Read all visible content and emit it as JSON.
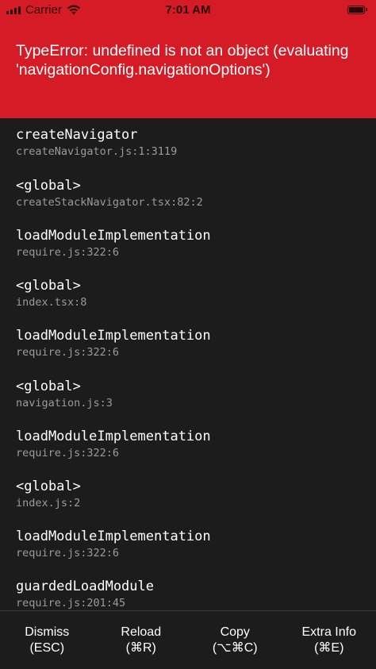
{
  "status_bar": {
    "carrier": "Carrier",
    "time": "7:01 AM",
    "icons": [
      "signal-icon",
      "wifi-icon",
      "battery-icon"
    ]
  },
  "error": {
    "message": "TypeError: undefined is not an object (evaluating 'navigationConfig.navigationOptions')"
  },
  "stack_frames": [
    {
      "method": "createNavigator",
      "location": "createNavigator.js:1:3119"
    },
    {
      "method": "<global>",
      "location": "createStackNavigator.tsx:82:2"
    },
    {
      "method": "loadModuleImplementation",
      "location": "require.js:322:6"
    },
    {
      "method": "<global>",
      "location": "index.tsx:8"
    },
    {
      "method": "loadModuleImplementation",
      "location": "require.js:322:6"
    },
    {
      "method": "<global>",
      "location": "navigation.js:3"
    },
    {
      "method": "loadModuleImplementation",
      "location": "require.js:322:6"
    },
    {
      "method": "<global>",
      "location": "index.js:2"
    },
    {
      "method": "loadModuleImplementation",
      "location": "require.js:322:6"
    },
    {
      "method": "guardedLoadModule",
      "location": "require.js:201:45"
    }
  ],
  "footer": {
    "dismiss": {
      "label": "Dismiss",
      "shortcut": "(ESC)"
    },
    "reload": {
      "label": "Reload",
      "shortcut": "(⌘R)"
    },
    "copy": {
      "label": "Copy",
      "shortcut": "(⌥⌘C)"
    },
    "extra_info": {
      "label": "Extra Info",
      "shortcut": "(⌘E)"
    }
  },
  "colors": {
    "header_red": "#d51b26",
    "background": "#1c1c1c",
    "location_gray": "#9b9b9b"
  }
}
